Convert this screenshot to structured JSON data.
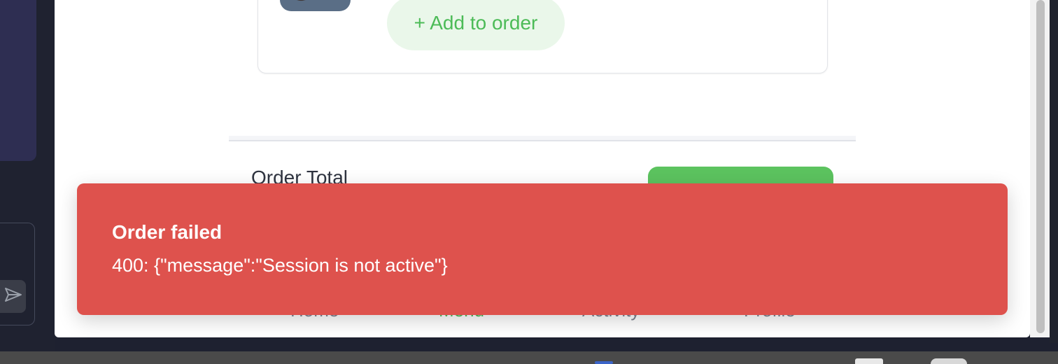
{
  "menu_item": {
    "add_button_label": "+ Add to order"
  },
  "order": {
    "total_label": "Order Total"
  },
  "bottom_nav": {
    "tabs": [
      {
        "label": "Home"
      },
      {
        "label": "Menu"
      },
      {
        "label": "Activity"
      },
      {
        "label": "Profile"
      }
    ],
    "active_tab": "Menu"
  },
  "toast": {
    "title": "Order failed",
    "message": "400: {\"message\":\"Session is not active\"}"
  },
  "icons": {
    "send": "send-icon"
  },
  "colors": {
    "toast_background": "#de524d",
    "accent_green": "#5cc35f",
    "add_button_text": "#4cbb57",
    "add_button_background": "#eaf7ea"
  }
}
